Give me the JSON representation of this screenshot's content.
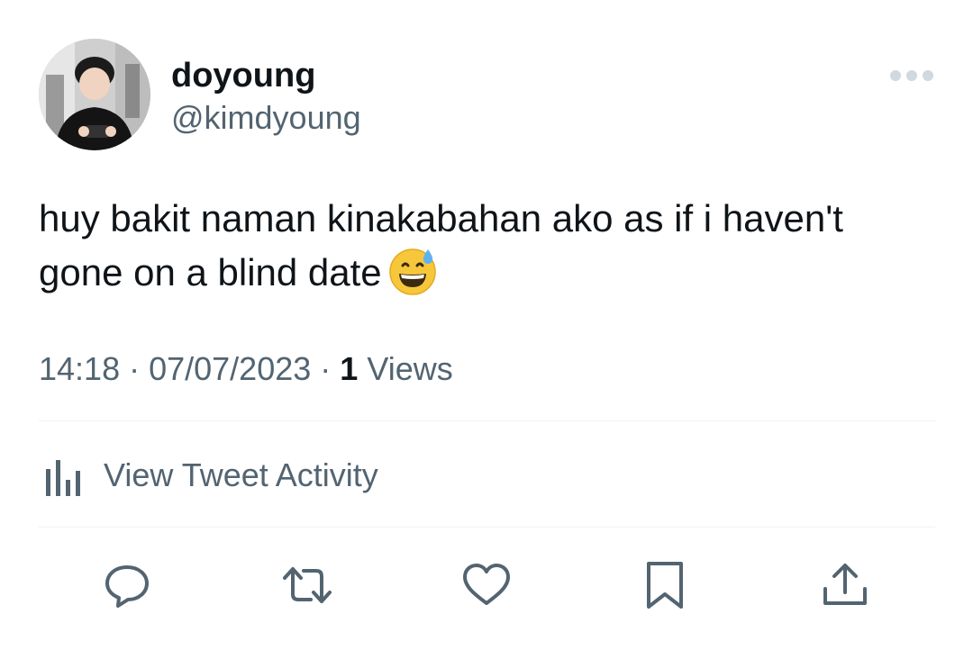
{
  "user": {
    "display_name": "doyoung",
    "handle": "@kimdyoung",
    "avatar_icon": "profile-photo"
  },
  "tweet": {
    "text": "huy bakit naman kinakabahan ako as if i haven't gone on a blind date",
    "emoji": "grinning-face-with-sweat"
  },
  "meta": {
    "time": "14:18",
    "separator": " · ",
    "date": "07/07/2023",
    "views_count": "1",
    "views_label": "Views"
  },
  "activity": {
    "label": "View Tweet Activity",
    "icon": "bar-chart-icon"
  },
  "actions": [
    {
      "name": "reply",
      "icon": "reply-icon"
    },
    {
      "name": "retweet",
      "icon": "retweet-icon"
    },
    {
      "name": "like",
      "icon": "heart-icon"
    },
    {
      "name": "bookmark",
      "icon": "bookmark-icon"
    },
    {
      "name": "share",
      "icon": "share-icon"
    }
  ],
  "colors": {
    "text_primary": "#0f1419",
    "text_secondary": "#536471",
    "divider": "#eff3f4",
    "icon": "#536471"
  }
}
